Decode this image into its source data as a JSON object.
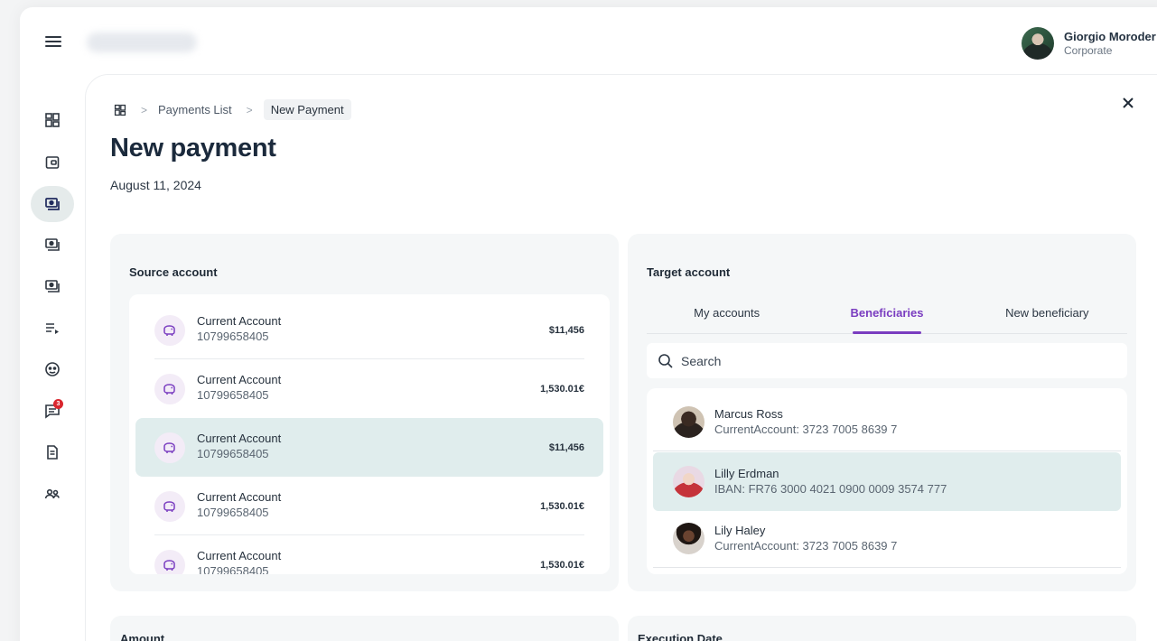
{
  "user": {
    "name": "Giorgio Moroder",
    "role": "Corporate"
  },
  "breadcrumb": {
    "items": [
      "Payments List",
      "New Payment"
    ]
  },
  "page": {
    "title": "New payment",
    "date": "August 11, 2024"
  },
  "rail": {
    "items": [
      {
        "icon": "dashboard-icon"
      },
      {
        "icon": "wallet-icon"
      },
      {
        "icon": "payments-icon",
        "active": true
      },
      {
        "icon": "payments-icon"
      },
      {
        "icon": "payments-icon"
      },
      {
        "icon": "list-play-icon"
      },
      {
        "icon": "support-icon"
      },
      {
        "icon": "messages-icon",
        "badge": "3"
      },
      {
        "icon": "document-icon"
      },
      {
        "icon": "users-icon"
      }
    ]
  },
  "source": {
    "title": "Source account",
    "accounts": [
      {
        "name": "Current Account",
        "number": "10799658405",
        "balance": "$11,456"
      },
      {
        "name": "Current Account",
        "number": "10799658405",
        "balance": "1,530.01€"
      },
      {
        "name": "Current Account",
        "number": "10799658405",
        "balance": "$11,456",
        "selected": true
      },
      {
        "name": "Current Account",
        "number": "10799658405",
        "balance": "1,530.01€"
      },
      {
        "name": "Current Account",
        "number": "10799658405",
        "balance": "1,530.01€"
      }
    ]
  },
  "target": {
    "title": "Target account",
    "tabs": [
      {
        "label": "My accounts"
      },
      {
        "label": "Beneficiaries",
        "active": true
      },
      {
        "label": "New beneficiary"
      }
    ],
    "search_placeholder": "Search",
    "beneficiaries": [
      {
        "name": "Marcus Ross",
        "detail": "CurrentAccount: 3723 7005 8639 7"
      },
      {
        "name": "Lilly Erdman",
        "detail": "IBAN: FR76 3000 4021 0900 0009 3574 777",
        "selected": true
      },
      {
        "name": "Lily Haley",
        "detail": "CurrentAccount: 3723 7005 8639 7"
      }
    ]
  },
  "sections": {
    "amount": "Amount",
    "execution_date": "Execution Date"
  },
  "colors": {
    "accent": "#7a3dc0",
    "selected_row": "#e0eded",
    "badge": "#d9262e"
  }
}
